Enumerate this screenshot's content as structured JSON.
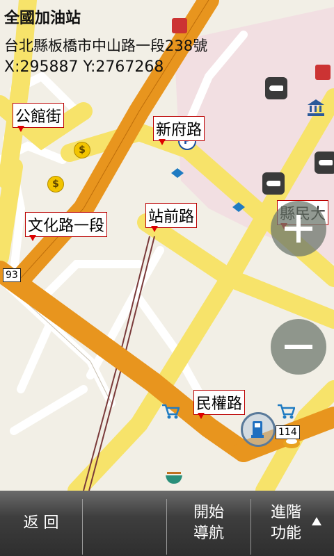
{
  "info": {
    "title": "全國加油站",
    "address": "台北縣板橋市中山路一段238號",
    "coords": "X:295887 Y:2767268"
  },
  "labels": {
    "gongguan": "公館街",
    "xinfu": "新府路",
    "wenhua": "文化路一段",
    "zhanqian": "站前路",
    "minquan": "民權路",
    "xianmin": "縣民大",
    "shield_93": "93",
    "shield_114": "114"
  },
  "icons": {
    "coin": "$"
  },
  "bottom_bar": {
    "back": "返 回",
    "start_nav_1": "開始",
    "start_nav_2": "導航",
    "advanced_1": "進階",
    "advanced_2": "功能"
  },
  "colors": {
    "primary_road": "#e8951e",
    "secondary_road": "#f7e36a",
    "minor_road": "#ffffff",
    "map_bg": "#f2efe6",
    "rail_area": "#f2dfe2"
  }
}
